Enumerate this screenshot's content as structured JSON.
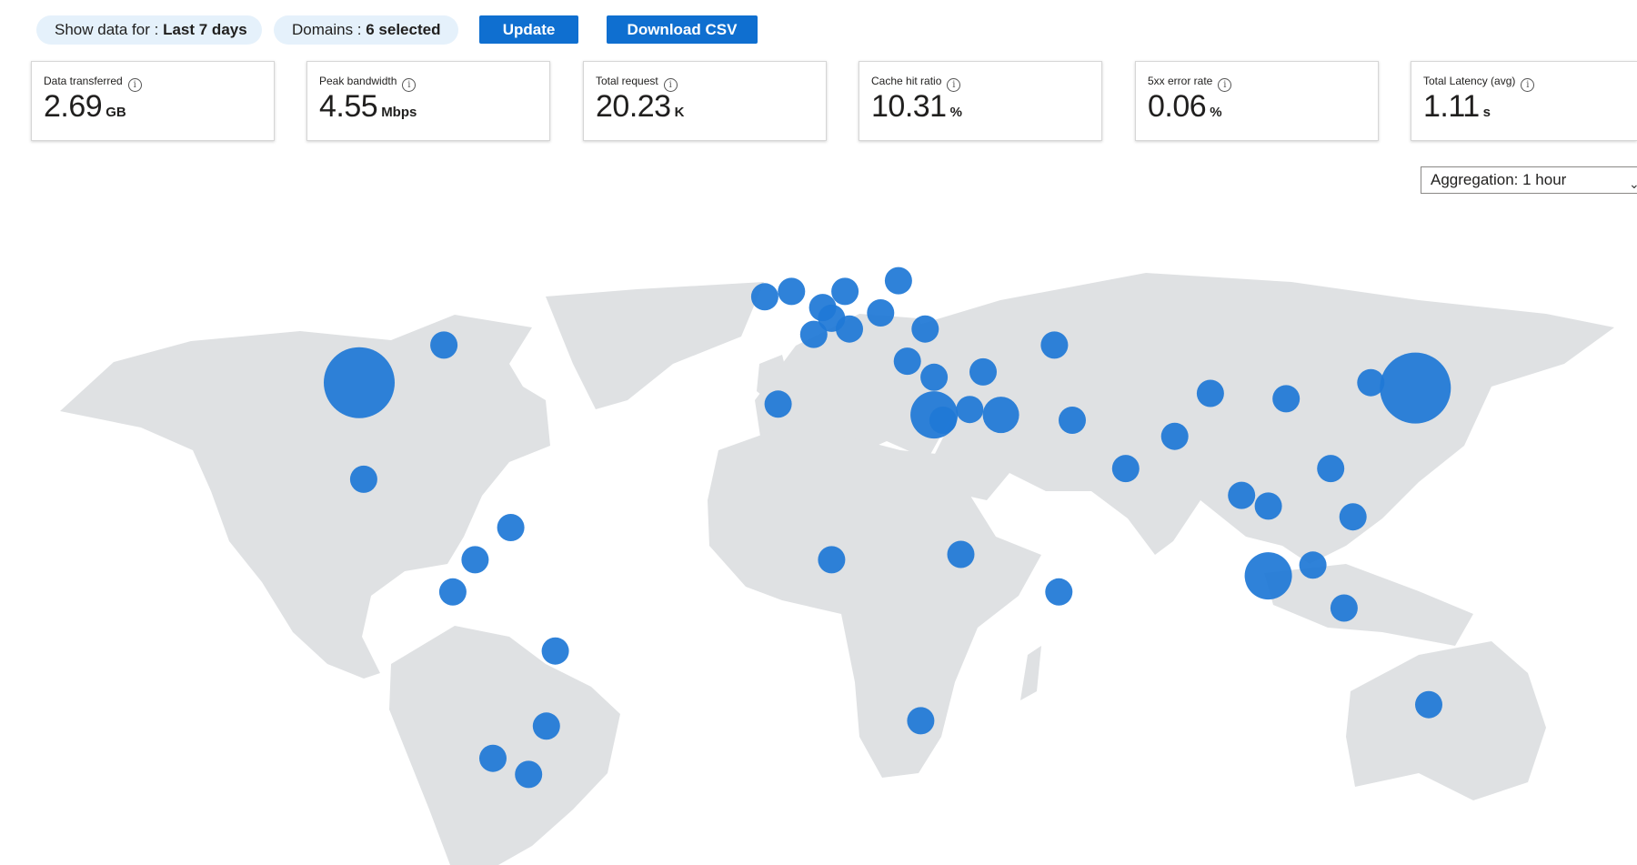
{
  "filters": {
    "time": {
      "label": "Show data for : ",
      "value": "Last 7 days"
    },
    "domains": {
      "label": "Domains : ",
      "value": "6 selected"
    },
    "update_button": "Update",
    "download_button": "Download CSV"
  },
  "metrics": [
    {
      "label": "Data transferred",
      "value": "2.69",
      "unit": "GB"
    },
    {
      "label": "Peak bandwidth",
      "value": "4.55",
      "unit": "Mbps"
    },
    {
      "label": "Total request",
      "value": "20.23",
      "unit": "K"
    },
    {
      "label": "Cache hit ratio",
      "value": "10.31",
      "unit": "%"
    },
    {
      "label": "5xx error rate",
      "value": "0.06",
      "unit": "%"
    },
    {
      "label": "Total Latency (avg)",
      "value": "1.11",
      "unit": "s"
    }
  ],
  "aggregation": {
    "label": "Aggregation: 1 hour"
  },
  "icons": {
    "info": "info-icon",
    "dropdown": "chevron-down-icon"
  },
  "colors": {
    "accent": "#0f6fd0",
    "bubble": "#1f78d6",
    "land": "#dfe1e3",
    "pill": "#e5f1fb"
  },
  "map": {
    "type": "bubble-map",
    "points": [
      {
        "lon": -81,
        "lat": 44,
        "size": 1
      },
      {
        "lon": -100,
        "lat": 37,
        "size": 4
      },
      {
        "lon": -99,
        "lat": 19,
        "size": 1
      },
      {
        "lon": -66,
        "lat": 10,
        "size": 1
      },
      {
        "lon": -74,
        "lat": 4,
        "size": 1
      },
      {
        "lon": -79,
        "lat": -2,
        "size": 1
      },
      {
        "lon": -56,
        "lat": -13,
        "size": 1
      },
      {
        "lon": -58,
        "lat": -27,
        "size": 1
      },
      {
        "lon": -70,
        "lat": -33,
        "size": 1
      },
      {
        "lon": -62,
        "lat": -36,
        "size": 1
      },
      {
        "lon": -9,
        "lat": 53,
        "size": 1
      },
      {
        "lon": -3,
        "lat": 54,
        "size": 1
      },
      {
        "lon": 4,
        "lat": 51,
        "size": 1
      },
      {
        "lon": 6,
        "lat": 49,
        "size": 1
      },
      {
        "lon": 9,
        "lat": 54,
        "size": 1
      },
      {
        "lon": 11,
        "lat": 62,
        "size": 1
      },
      {
        "lon": 22,
        "lat": 64,
        "size": 1
      },
      {
        "lon": 21,
        "lat": 56,
        "size": 1
      },
      {
        "lon": 17,
        "lat": 50,
        "size": 1
      },
      {
        "lon": 2,
        "lat": 46,
        "size": 1
      },
      {
        "lon": 10,
        "lat": 47,
        "size": 1
      },
      {
        "lon": 27,
        "lat": 47,
        "size": 1
      },
      {
        "lon": 23,
        "lat": 41,
        "size": 1
      },
      {
        "lon": -6,
        "lat": 33,
        "size": 1
      },
      {
        "lon": 29,
        "lat": 38,
        "size": 1
      },
      {
        "lon": 29,
        "lat": 31,
        "size": 3
      },
      {
        "lon": 31,
        "lat": 30,
        "size": 1
      },
      {
        "lon": 37,
        "lat": 32,
        "size": 1
      },
      {
        "lon": 40,
        "lat": 39,
        "size": 1
      },
      {
        "lon": 44,
        "lat": 31,
        "size": 2
      },
      {
        "lon": 56,
        "lat": 44,
        "size": 1
      },
      {
        "lon": 60,
        "lat": 30,
        "size": 1
      },
      {
        "lon": 74,
        "lat": 70,
        "size": 1
      },
      {
        "lon": 72,
        "lat": 21,
        "size": 1
      },
      {
        "lon": 83,
        "lat": 27,
        "size": 1
      },
      {
        "lon": 91,
        "lat": 35,
        "size": 1
      },
      {
        "lon": 108,
        "lat": 34,
        "size": 1
      },
      {
        "lon": 118,
        "lat": 21,
        "size": 1
      },
      {
        "lon": 98,
        "lat": 16,
        "size": 1
      },
      {
        "lon": 104,
        "lat": 14,
        "size": 1
      },
      {
        "lon": 104,
        "lat": 1,
        "size": 3
      },
      {
        "lon": 114,
        "lat": 3,
        "size": 1
      },
      {
        "lon": 123,
        "lat": 12,
        "size": 1
      },
      {
        "lon": 121,
        "lat": -5,
        "size": 1
      },
      {
        "lon": 127,
        "lat": 37,
        "size": 1
      },
      {
        "lon": 137,
        "lat": 36,
        "size": 4
      },
      {
        "lon": 6,
        "lat": 4,
        "size": 1
      },
      {
        "lon": 35,
        "lat": 5,
        "size": 1
      },
      {
        "lon": 57,
        "lat": -2,
        "size": 1
      },
      {
        "lon": 26,
        "lat": -26,
        "size": 1
      },
      {
        "lon": 140,
        "lat": -23,
        "size": 1
      }
    ]
  }
}
